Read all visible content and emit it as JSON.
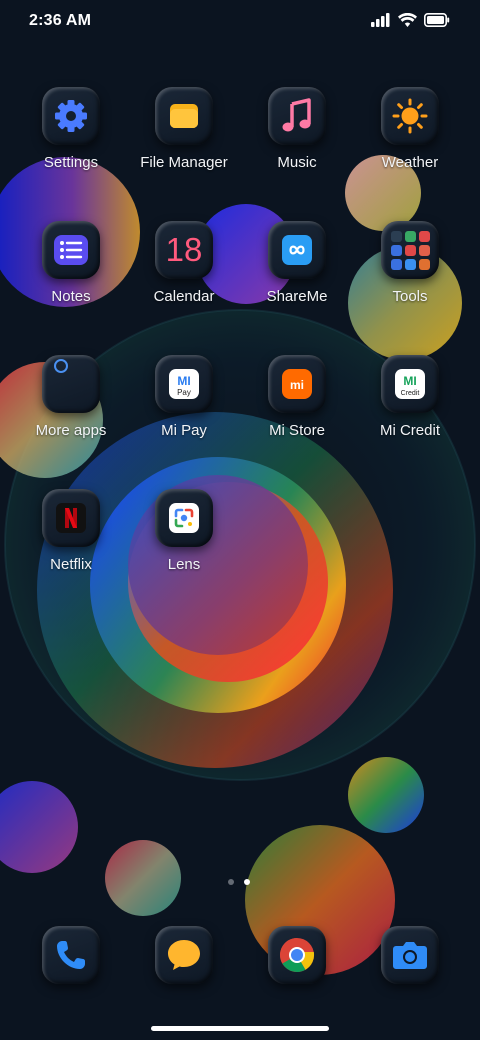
{
  "status_bar": {
    "time": "2:36 AM"
  },
  "apps": {
    "settings": "Settings",
    "file_manager": "File Manager",
    "music": "Music",
    "weather": "Weather",
    "notes": "Notes",
    "calendar": "Calendar",
    "calendar_day": "18",
    "shareme": "ShareMe",
    "tools": "Tools",
    "more_apps": "More apps",
    "mi_pay": "Mi Pay",
    "mi_store": "Mi Store",
    "mi_credit": "Mi Credit",
    "netflix": "Netflix",
    "lens": "Lens"
  },
  "pager": {
    "pages": 2,
    "active": 2
  },
  "dock": [
    "phone-icon",
    "messages-icon",
    "chrome-icon",
    "camera-icon"
  ],
  "colors": {
    "background": "#0b1420",
    "calendar_accent": "#ff5a7d",
    "settings_blue": "#4a7bff"
  }
}
